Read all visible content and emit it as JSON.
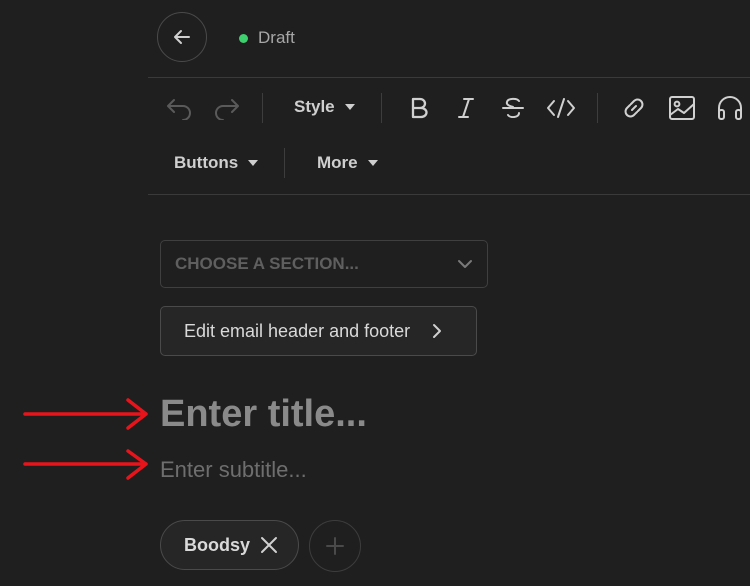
{
  "header": {
    "back_icon": "arrow-left-icon",
    "status_text": "Draft",
    "status_color": "#3ecf6e"
  },
  "toolbar": {
    "style_label": "Style",
    "buttons_label": "Buttons",
    "more_label": "More",
    "icons": [
      "undo-icon",
      "redo-icon",
      "bold-icon",
      "italic-icon",
      "strikethrough-icon",
      "code-icon",
      "link-icon",
      "image-icon",
      "headphones-icon"
    ]
  },
  "editor": {
    "section_placeholder": "CHOOSE A SECTION...",
    "header_footer_label": "Edit email header and footer",
    "title_placeholder": "Enter title...",
    "subtitle_placeholder": "Enter subtitle...",
    "tags": [
      "Boodsy"
    ]
  },
  "annotations": {
    "arrow_color": "#e8141c"
  }
}
